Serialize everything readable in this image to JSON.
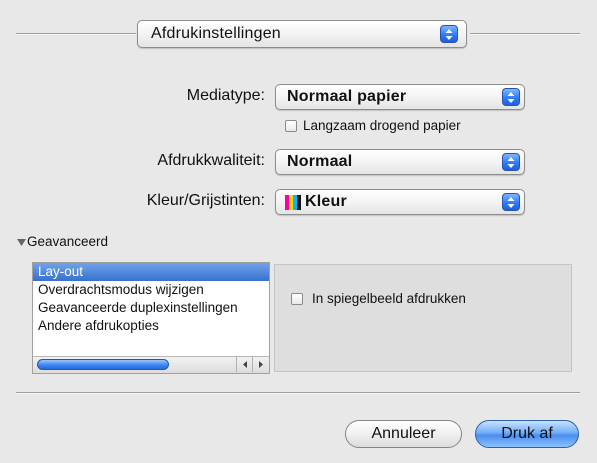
{
  "header": {
    "panel_popup": "Afdrukinstellingen"
  },
  "settings": {
    "mediatype_label": "Mediatype:",
    "mediatype_value": "Normaal papier",
    "slow_drying_label": "Langzaam drogend papier",
    "quality_label": "Afdrukkwaliteit:",
    "quality_value": "Normaal",
    "color_label": "Kleur/Grijstinten:",
    "color_value": "Kleur"
  },
  "advanced": {
    "disclosure_label": "Geavanceerd",
    "list_items": [
      "Lay-out",
      "Overdrachtsmodus wijzigen",
      "Geavanceerde duplexinstellingen",
      "Andere afdrukopties"
    ],
    "selected_index": 0,
    "mirror_label": "In spiegelbeeld afdrukken"
  },
  "footer": {
    "cancel_label": "Annuleer",
    "print_label": "Druk af"
  },
  "colors": {
    "selection": "#3771cf",
    "default_button": "#4b8ef0"
  }
}
